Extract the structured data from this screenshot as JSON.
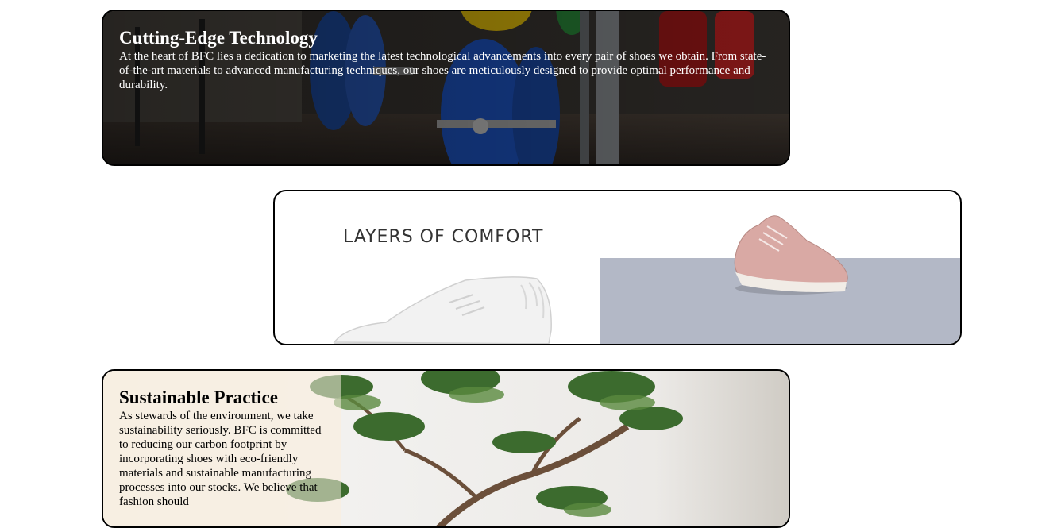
{
  "cards": [
    {
      "title": "Cutting-Edge Technology",
      "body": "At the heart of BFC lies a dedication to marketing the latest technological advancements into every pair of shoes we obtain. From state-of-the-art materials to advanced manufacturing techniques, our shoes are meticulously designed to provide optimal performance and durability."
    },
    {
      "image_text": "LAYERS OF COMFORT"
    },
    {
      "title": "Sustainable Practice",
      "body": "As stewards of the environment, we take sustainability seriously. BFC is committed to reducing our carbon footprint by incorporating shoes with eco-friendly materials and sustainable manufacturing processes into our stocks. We believe that fashion should"
    }
  ],
  "colors": {
    "border": "#000000",
    "comfort_panel": "#b3b8c6",
    "white_shoe": "#f4f4f4",
    "pink_shoe": "#d9a9a4"
  },
  "icons": [
    "gym-weights-image",
    "white-shoe-image",
    "pink-shoe-image",
    "bonsai-tree-image"
  ]
}
